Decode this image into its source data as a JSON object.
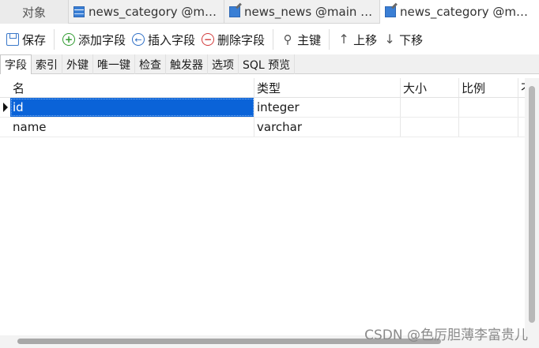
{
  "doc_tabs": [
    {
      "label": "对象"
    },
    {
      "label": "news_category @mai..."
    },
    {
      "label": "news_news @main (1..."
    },
    {
      "label": "news_category @mai..."
    }
  ],
  "toolbar": {
    "save": "保存",
    "add_field": "添加字段",
    "insert_field": "插入字段",
    "delete_field": "删除字段",
    "primary_key": "主键",
    "move_up": "上移",
    "move_down": "下移"
  },
  "sub_tabs": [
    "字段",
    "索引",
    "外键",
    "唯一键",
    "检查",
    "触发器",
    "选项",
    "SQL 预览"
  ],
  "grid": {
    "columns": {
      "name": "名",
      "type": "类型",
      "size": "大小",
      "ratio": "比例",
      "more": "不"
    },
    "rows": [
      {
        "name": "id",
        "type": "integer",
        "size": "",
        "ratio": "",
        "selected": true
      },
      {
        "name": "name",
        "type": "varchar",
        "size": "",
        "ratio": "",
        "selected": false
      }
    ]
  },
  "watermark": "CSDN @色厉胆薄李富贵儿"
}
